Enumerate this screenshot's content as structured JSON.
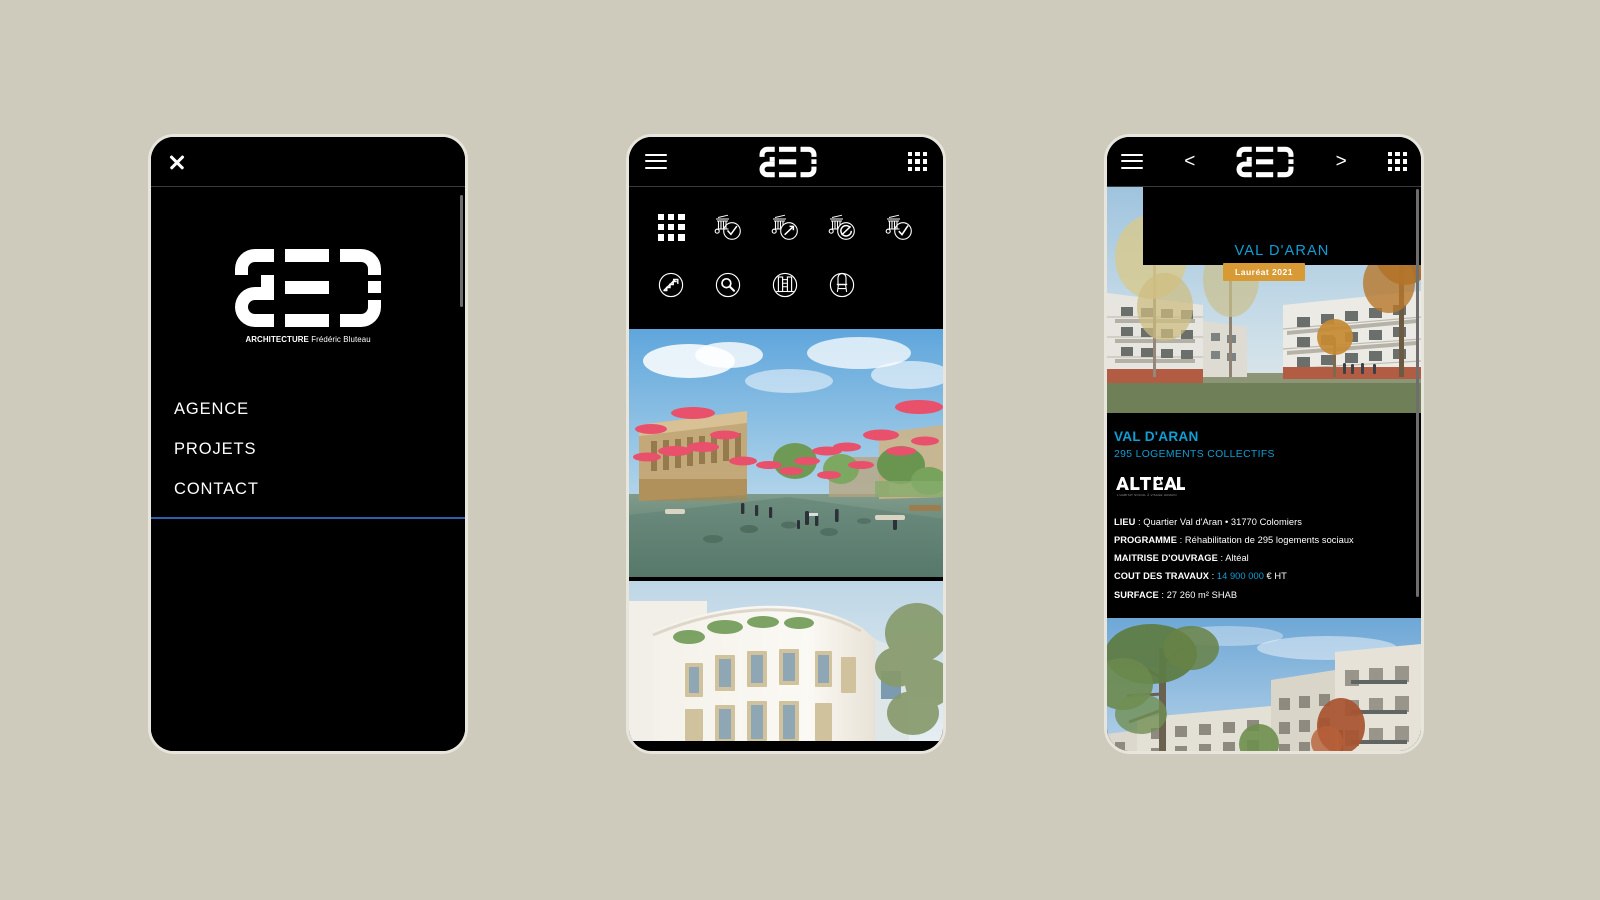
{
  "background_color": "#cecbbc",
  "brand": {
    "logo_name": "aeb-monogram",
    "wordmark_bold": "ARCHITECTURE",
    "wordmark_light": "Frédéric Bluteau",
    "accent_blue": "#0f9ed5",
    "menu_underline_blue": "#2c5fad",
    "badge_gold": "#d79a34"
  },
  "phone1": {
    "name": "menu-panel",
    "topbar": {
      "close_icon": "close-icon"
    },
    "menu": {
      "items": [
        {
          "label": "AGENCE",
          "name": "menu-item-agence"
        },
        {
          "label": "PROJETS",
          "name": "menu-item-projets"
        },
        {
          "label": "CONTACT",
          "name": "menu-item-contact"
        }
      ]
    }
  },
  "phone2": {
    "name": "projects-grid-panel",
    "topbar": {
      "menu_icon": "hamburger-icon",
      "logo": "aeb-monogram",
      "grid_icon": "grid-view-icon"
    },
    "filters": {
      "row1": [
        {
          "name": "filter-all-grid-icon",
          "label": "grid-icon"
        },
        {
          "name": "filter-housing-leaf-icon",
          "label": "building-leaf-icon"
        },
        {
          "name": "filter-housing-arrow-icon",
          "label": "building-arrow-icon"
        },
        {
          "name": "filter-housing-renovate-icon",
          "label": "building-renovate-icon"
        },
        {
          "name": "filter-housing-check-icon",
          "label": "building-check-icon"
        }
      ],
      "row2": [
        {
          "name": "filter-stairs-icon",
          "label": "stairs-icon"
        },
        {
          "name": "filter-search-icon",
          "label": "magnifier-icon"
        },
        {
          "name": "filter-facade-icon",
          "label": "facade-icon"
        },
        {
          "name": "filter-chair-icon",
          "label": "chair-icon"
        }
      ]
    },
    "photos": [
      {
        "name": "project-photo-plaza",
        "alt": "plaza with pink canopies"
      },
      {
        "name": "project-photo-white-building",
        "alt": "white curved residential building"
      }
    ]
  },
  "phone3": {
    "name": "project-detail-panel",
    "topbar": {
      "menu_icon": "hamburger-icon",
      "prev_label": "<",
      "logo": "aeb-monogram",
      "next_label": ">",
      "grid_icon": "grid-view-icon"
    },
    "hero": {
      "title": "VAL D'ARAN",
      "badge": "Lauréat 2021",
      "photo_name": "hero-photo-val-daran"
    },
    "detail": {
      "title": "VAL D'ARAN",
      "subtitle": "295 LOGEMENTS COLLECTIFS",
      "client_logo": "ALTÉAL",
      "client_tagline": "L'HABITAT SOCIAL À VISAGE HUMAIN",
      "rows": [
        {
          "label": "LIEU",
          "value": "Quartier Val d'Aran • 31770 Colomiers"
        },
        {
          "label": "PROGRAMME",
          "value": "Réhabilitation de 295 logements sociaux"
        },
        {
          "label": "MAITRISE D'OUVRAGE",
          "value": "Altéal"
        },
        {
          "label": "COUT DES TRAVAUX",
          "value_accent": "14 900 000",
          "value": " € HT"
        },
        {
          "label": "SURFACE",
          "value": "27 260 m² SHAB"
        }
      ]
    },
    "bottom_photo": {
      "name": "project-photo-courtyard",
      "alt": "courtyard residential render"
    }
  }
}
